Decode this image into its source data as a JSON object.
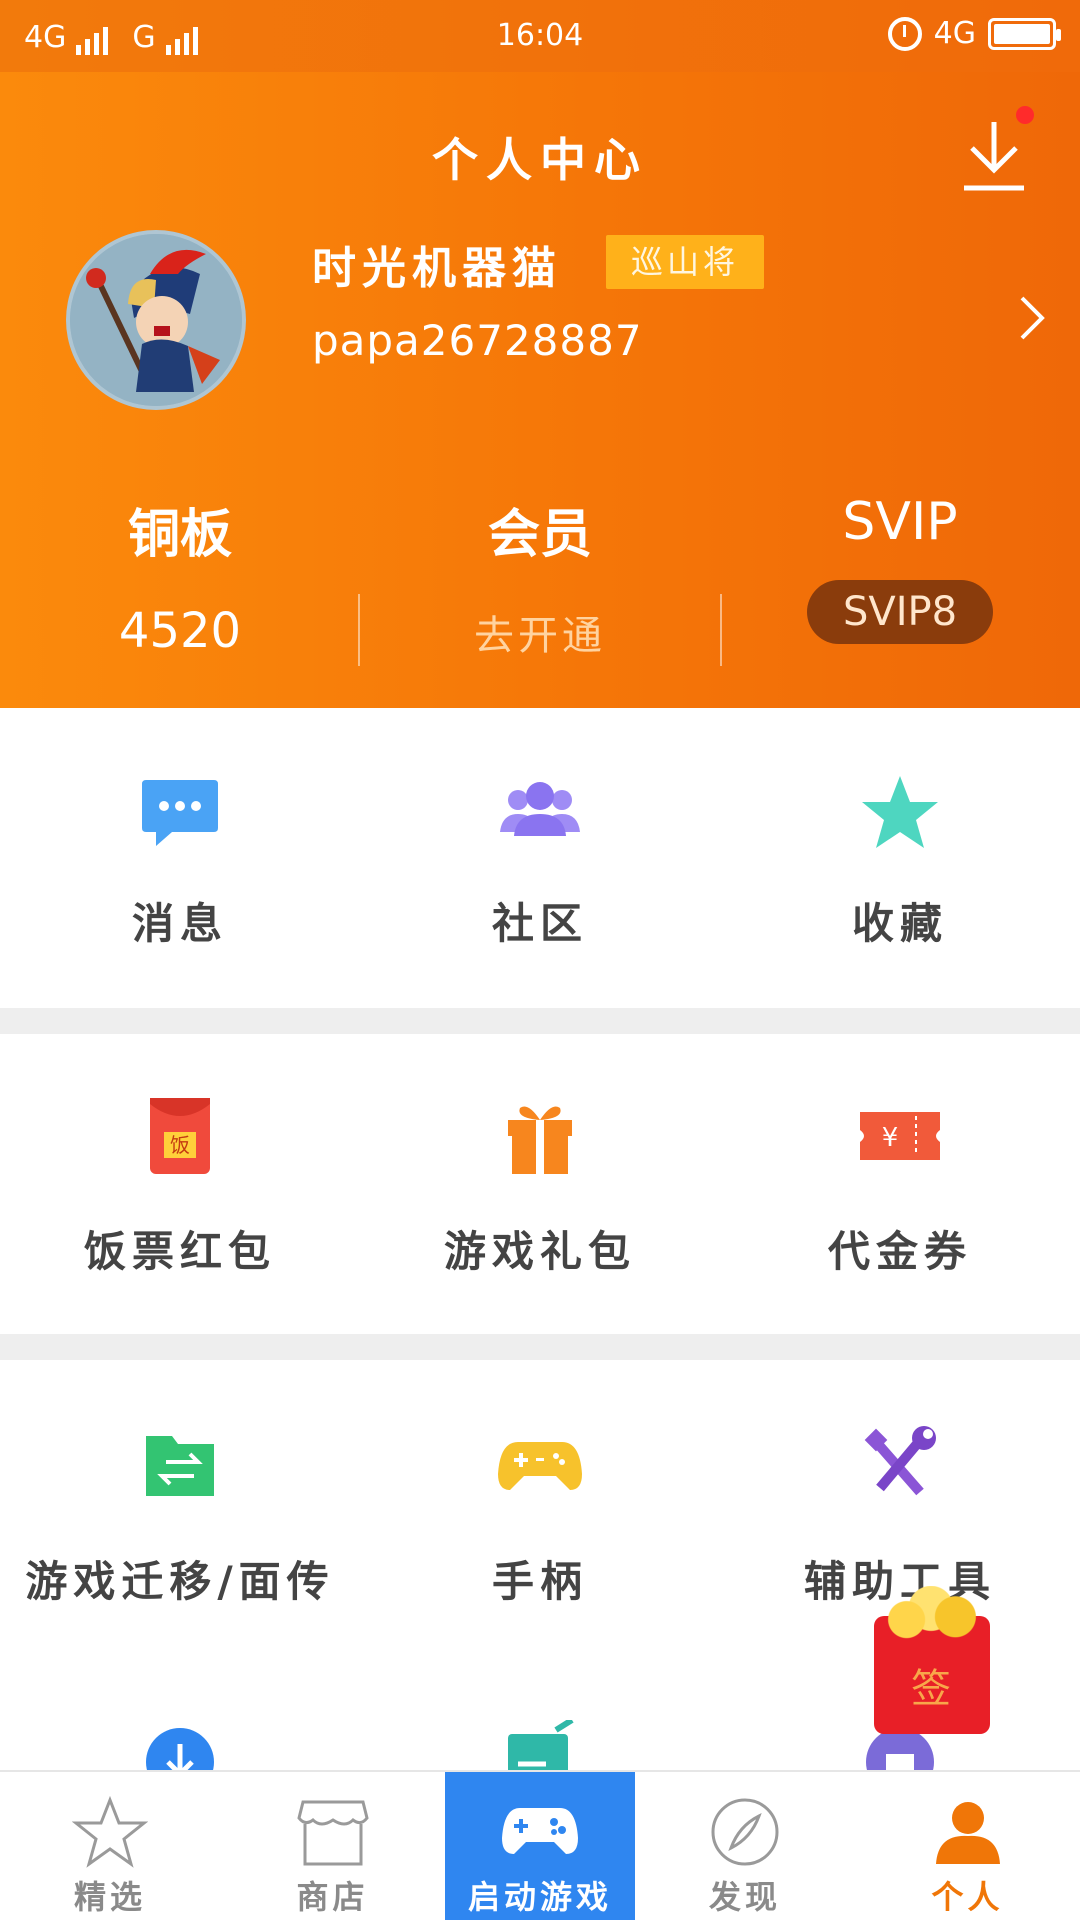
{
  "status_bar": {
    "left_network_1": "4G",
    "left_network_2": "G",
    "time": "16:04",
    "right_network": "4G"
  },
  "header": {
    "title": "个人中心",
    "username": "时光机器猫",
    "rank_badge": "巡山将",
    "user_id": "papa26728887",
    "colors": {
      "gradient_start": "#fb8a0c",
      "gradient_end": "#ef6808",
      "badge": "#ffb11a",
      "svip_pill": "#8a3c0c"
    }
  },
  "stats": {
    "coins": {
      "label": "铜板",
      "value": "4520"
    },
    "member": {
      "label": "会员",
      "action": "去开通"
    },
    "svip": {
      "label": "SVIP",
      "level": "SVIP8"
    }
  },
  "grid": {
    "row1": [
      {
        "label": "消息",
        "icon": "message-icon"
      },
      {
        "label": "社区",
        "icon": "community-icon"
      },
      {
        "label": "收藏",
        "icon": "star-icon"
      }
    ],
    "row2": [
      {
        "label": "饭票红包",
        "icon": "red-envelope-icon",
        "icon_text": "饭"
      },
      {
        "label": "游戏礼包",
        "icon": "gift-icon"
      },
      {
        "label": "代金券",
        "icon": "coupon-icon",
        "icon_text": "¥"
      }
    ],
    "row3": [
      {
        "label": "游戏迁移/面传",
        "icon": "transfer-icon"
      },
      {
        "label": "手柄",
        "icon": "gamepad-icon"
      },
      {
        "label": "辅助工具",
        "icon": "tools-icon"
      }
    ]
  },
  "sign_in_float": {
    "label": "签"
  },
  "bottom_nav": {
    "items": [
      {
        "label": "精选",
        "icon": "star-outline-icon"
      },
      {
        "label": "商店",
        "icon": "store-icon"
      },
      {
        "label": "启动游戏",
        "icon": "gamepad-icon"
      },
      {
        "label": "发现",
        "icon": "compass-icon"
      },
      {
        "label": "个人",
        "icon": "person-icon"
      }
    ],
    "launch_color": "#2f86f0",
    "selected_color": "#f07608"
  }
}
